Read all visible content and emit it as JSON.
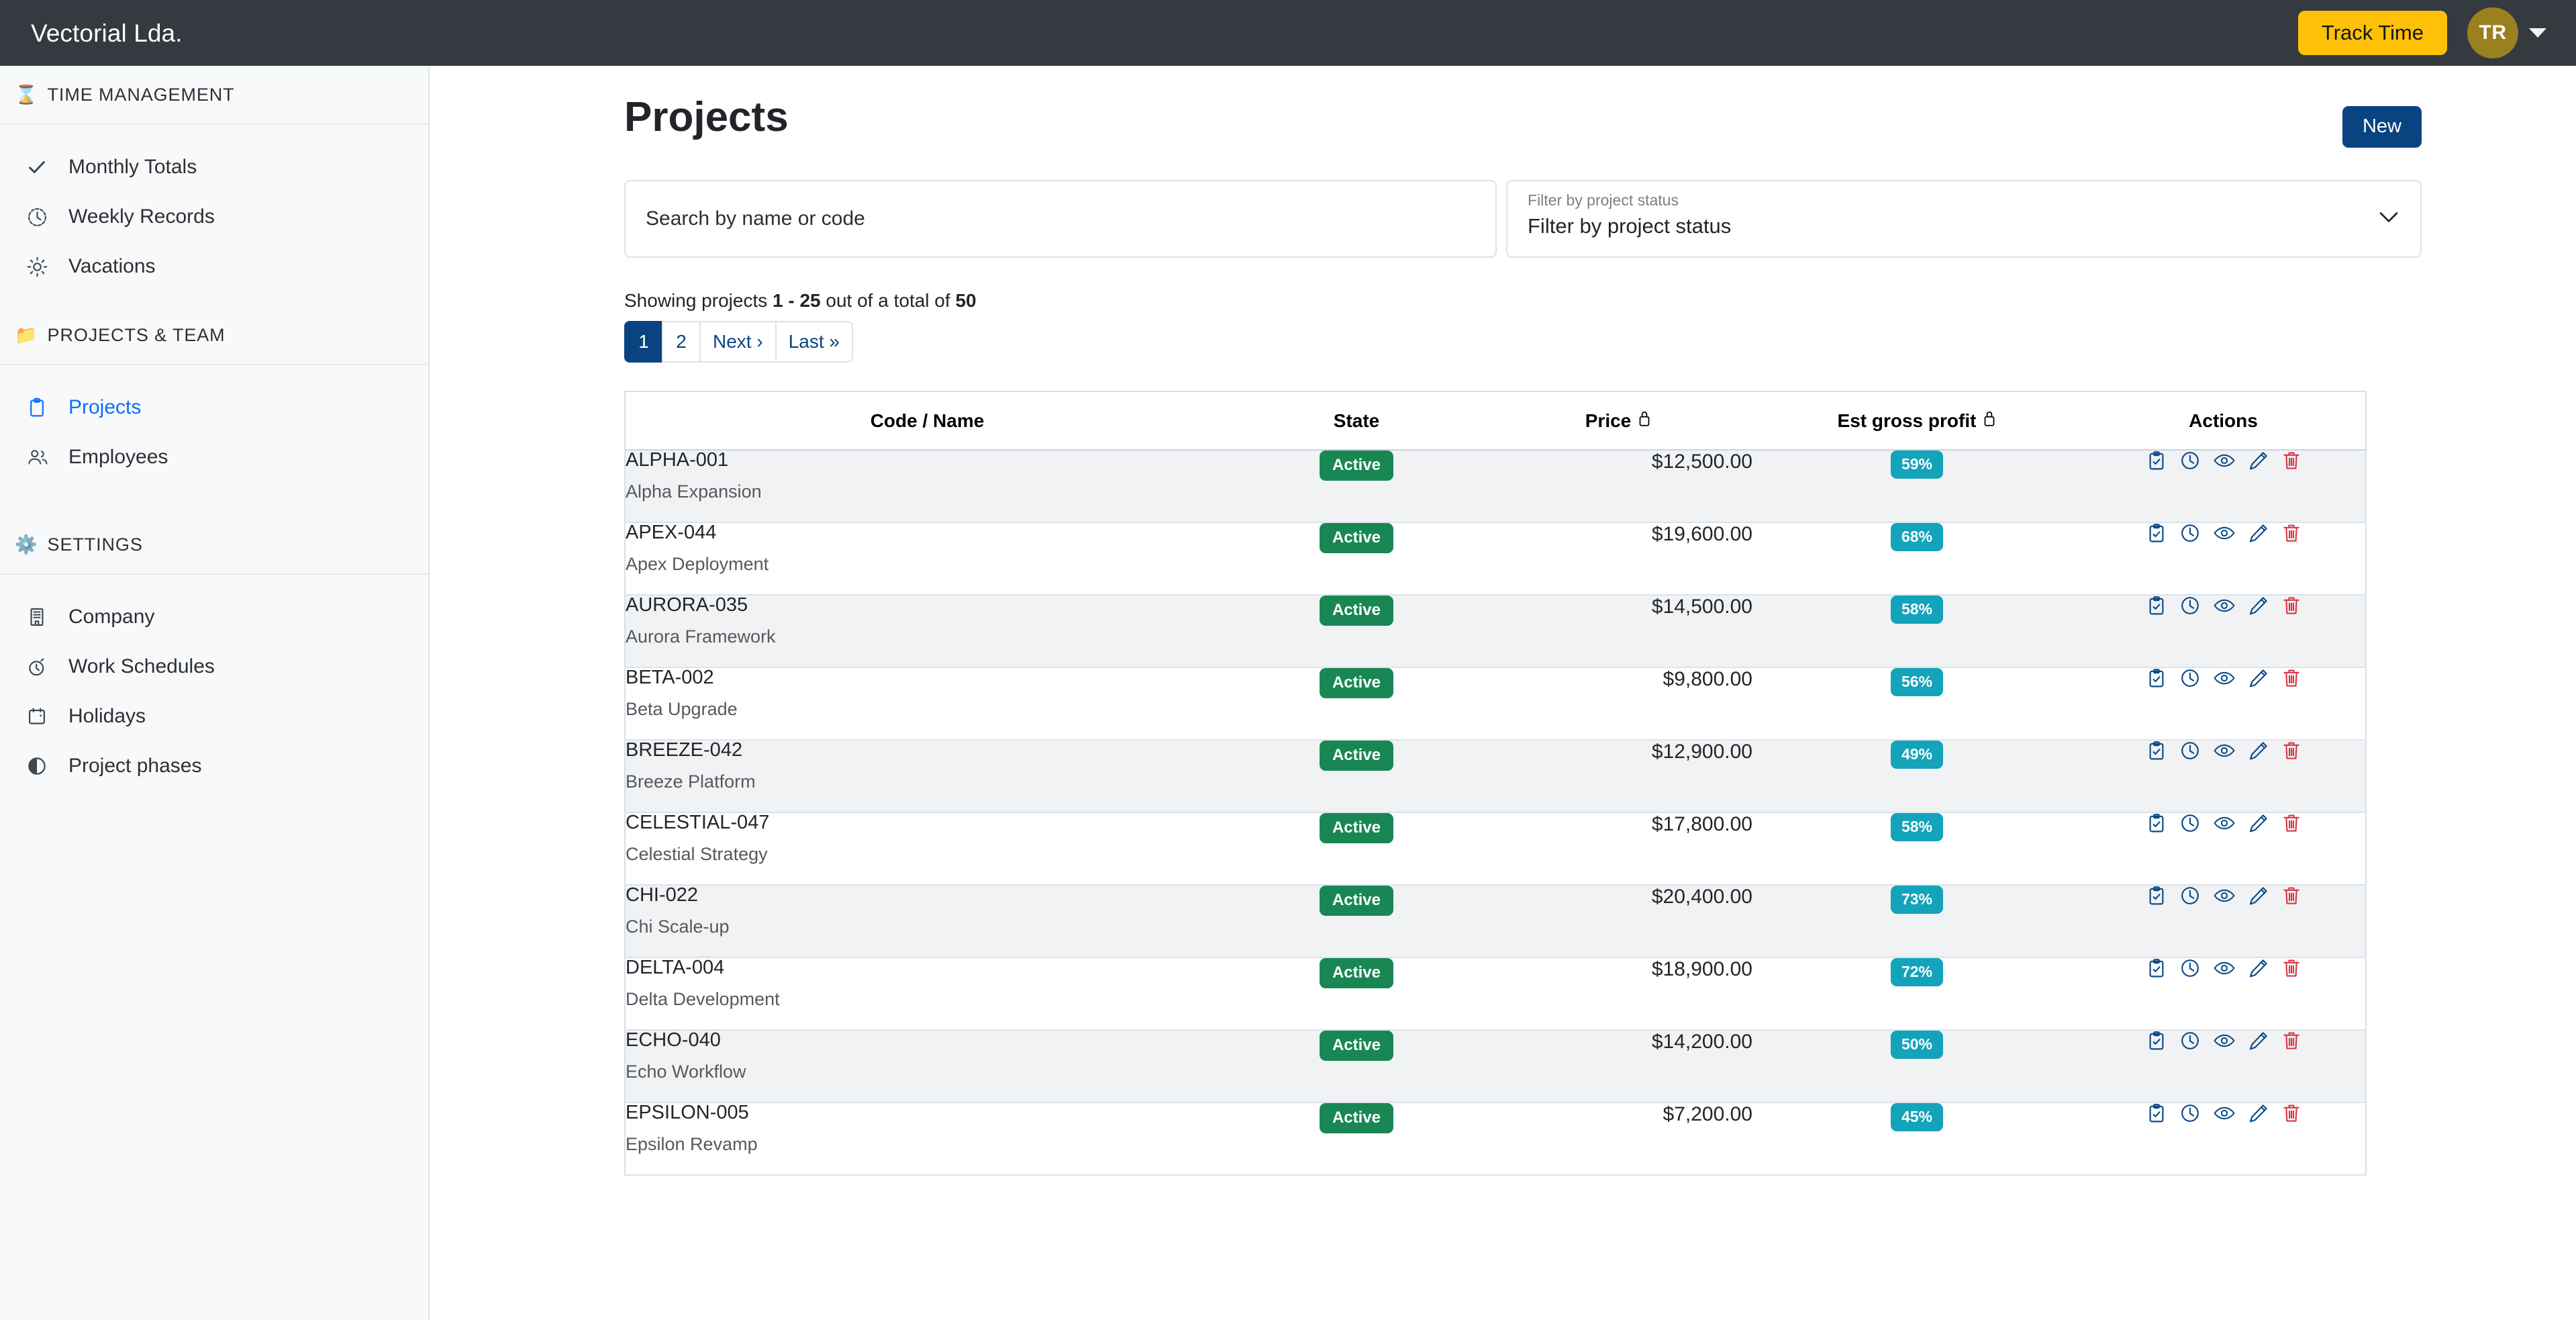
{
  "topbar": {
    "brand": "Vectorial Lda.",
    "track_time_label": "Track Time",
    "avatar_initials": "TR",
    "brand_bg": "#343a40",
    "track_time_bg": "#ffc107",
    "avatar_bg": "#9a801f"
  },
  "sidebar": {
    "sections": [
      {
        "icon": "hourglass-icon",
        "emoji": "⌛",
        "label": "TIME MANAGEMENT",
        "items": [
          {
            "label": "Monthly Totals",
            "icon": "check-icon",
            "active": false
          },
          {
            "label": "Weekly Records",
            "icon": "clock-dashed-icon",
            "active": false
          },
          {
            "label": "Vacations",
            "icon": "sun-icon",
            "active": false
          }
        ]
      },
      {
        "icon": "folder-icon",
        "emoji": "📁",
        "label": "PROJECTS & TEAM",
        "items": [
          {
            "label": "Projects",
            "icon": "clipboard-icon",
            "active": true
          },
          {
            "label": "Employees",
            "icon": "people-icon",
            "active": false
          }
        ]
      },
      {
        "icon": "gear-icon",
        "emoji": "⚙️",
        "label": "SETTINGS",
        "items": [
          {
            "label": "Company",
            "icon": "building-icon",
            "active": false
          },
          {
            "label": "Work Schedules",
            "icon": "stopwatch-icon",
            "active": false
          },
          {
            "label": "Holidays",
            "icon": "calendar-icon",
            "active": false
          },
          {
            "label": "Project phases",
            "icon": "half-circle-icon",
            "active": false
          }
        ]
      }
    ],
    "active_color": "#0d6efd"
  },
  "page": {
    "title": "Projects",
    "new_button_label": "New",
    "new_button_bg": "#0a4480"
  },
  "search": {
    "placeholder": "Search by name or code",
    "value": ""
  },
  "status_filter": {
    "float_label": "Filter by project status",
    "selected": "Filter by project status"
  },
  "summary": {
    "prefix": "Showing projects ",
    "range": "1 - 25",
    "middle": " out of a total of ",
    "total": "50"
  },
  "pagination": {
    "items": [
      {
        "label": "1",
        "current": true
      },
      {
        "label": "2",
        "current": false
      },
      {
        "label": "Next ›",
        "current": false
      },
      {
        "label": "Last »",
        "current": false
      }
    ]
  },
  "table": {
    "columns": [
      {
        "label": "Code / Name",
        "lock": false
      },
      {
        "label": "State",
        "lock": false
      },
      {
        "label": "Price",
        "lock": true
      },
      {
        "label": "Est gross profit",
        "lock": true
      },
      {
        "label": "Actions",
        "lock": false
      }
    ],
    "state_badge_bg": "#198754",
    "profit_badge_bg": "#13a3ba",
    "action_icons": [
      "clipboard-check-icon",
      "clock-icon",
      "eye-icon",
      "pencil-icon",
      "trash-icon"
    ],
    "rows": [
      {
        "code": "ALPHA-001",
        "name": "Alpha Expansion",
        "state": "Active",
        "price": "$12,500.00",
        "profit": "59%"
      },
      {
        "code": "APEX-044",
        "name": "Apex Deployment",
        "state": "Active",
        "price": "$19,600.00",
        "profit": "68%"
      },
      {
        "code": "AURORA-035",
        "name": "Aurora Framework",
        "state": "Active",
        "price": "$14,500.00",
        "profit": "58%"
      },
      {
        "code": "BETA-002",
        "name": "Beta Upgrade",
        "state": "Active",
        "price": "$9,800.00",
        "profit": "56%"
      },
      {
        "code": "BREEZE-042",
        "name": "Breeze Platform",
        "state": "Active",
        "price": "$12,900.00",
        "profit": "49%"
      },
      {
        "code": "CELESTIAL-047",
        "name": "Celestial Strategy",
        "state": "Active",
        "price": "$17,800.00",
        "profit": "58%"
      },
      {
        "code": "CHI-022",
        "name": "Chi Scale-up",
        "state": "Active",
        "price": "$20,400.00",
        "profit": "73%"
      },
      {
        "code": "DELTA-004",
        "name": "Delta Development",
        "state": "Active",
        "price": "$18,900.00",
        "profit": "72%"
      },
      {
        "code": "ECHO-040",
        "name": "Echo Workflow",
        "state": "Active",
        "price": "$14,200.00",
        "profit": "50%"
      },
      {
        "code": "EPSILON-005",
        "name": "Epsilon Revamp",
        "state": "Active",
        "price": "$7,200.00",
        "profit": "45%"
      }
    ]
  }
}
